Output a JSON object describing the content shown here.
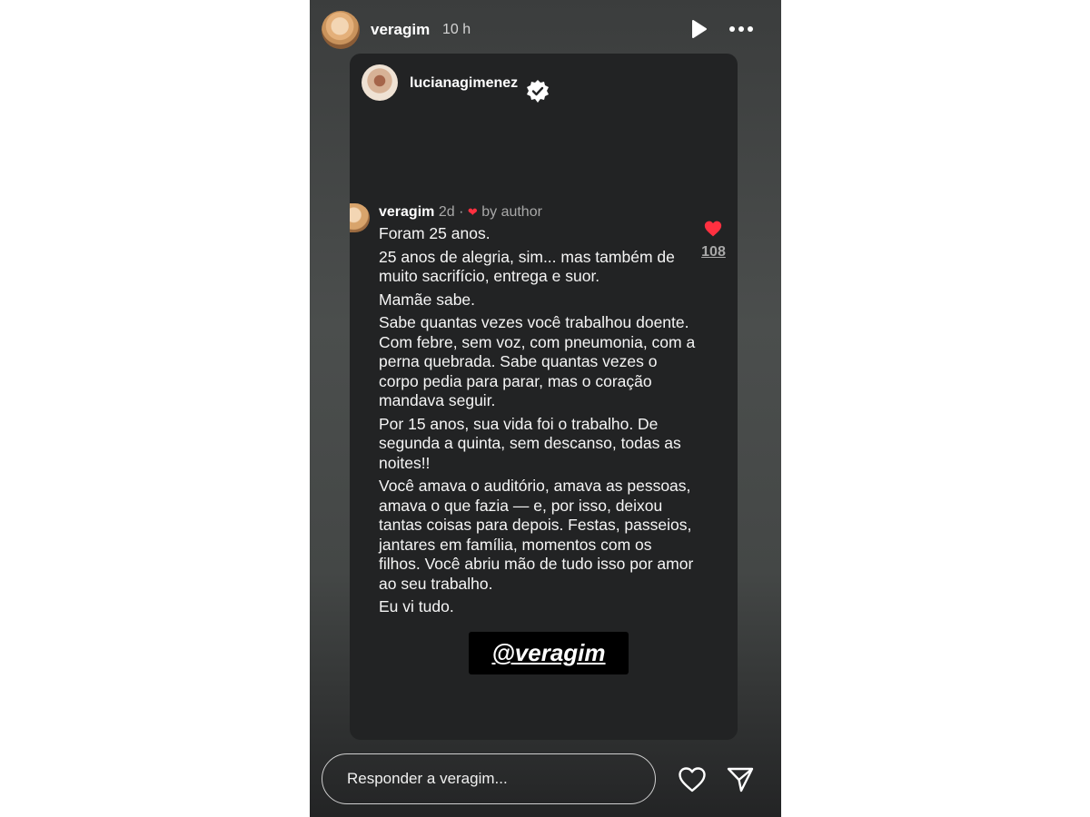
{
  "header": {
    "username": "veragim",
    "time": "10 h",
    "play_icon": "play-icon",
    "more_icon": "more-options-icon"
  },
  "shared_post": {
    "username": "lucianagimenez",
    "verified_icon": "verified-badge-icon"
  },
  "comment": {
    "username": "veragim",
    "age": "2d",
    "separator": "·",
    "liked_label": "by author",
    "paragraphs": [
      "Foram 25 anos.",
      "25 anos de alegria, sim... mas também de muito sacrifício, entrega e suor.",
      "Mamãe sabe.",
      "Sabe quantas vezes você trabalhou doente. Com febre, sem voz, com pneumonia, com a perna quebrada. Sabe quantas vezes o corpo pedia para parar, mas o coração mandava seguir.",
      "Por 15 anos, sua vida foi o trabalho. De segunda a quinta, sem descanso, todas as noites!!",
      "Você amava o auditório, amava as pessoas, amava o que fazia — e, por isso, deixou tantas coisas para depois. Festas, passeios, jantares em família, momentos com os filhos. Você abriu mão de tudo isso por amor ao seu trabalho.",
      "Eu vi tudo."
    ],
    "like_count": "108"
  },
  "mention_sticker": "@veragim",
  "reply": {
    "placeholder": "Responder a veragim..."
  },
  "colors": {
    "like_red": "#ff3040",
    "card_bg": "#222324"
  }
}
